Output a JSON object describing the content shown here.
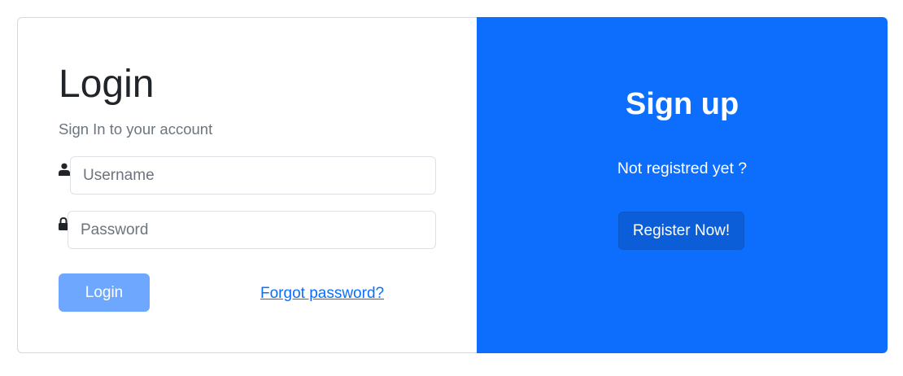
{
  "login": {
    "title": "Login",
    "subtitle": "Sign In to your account",
    "username_placeholder": "Username",
    "password_placeholder": "Password",
    "login_label": "Login",
    "forgot_label": "Forgot password?",
    "user_icon": "user-icon",
    "lock_icon": "lock-icon"
  },
  "signup": {
    "title": "Sign up",
    "text": "Not registred yet ?",
    "register_label": "Register Now!"
  },
  "colors": {
    "primary": "#0d6efd",
    "login_button": "#6ea8fe",
    "register_button": "#0b5ed7",
    "muted_text": "#6c757d"
  }
}
